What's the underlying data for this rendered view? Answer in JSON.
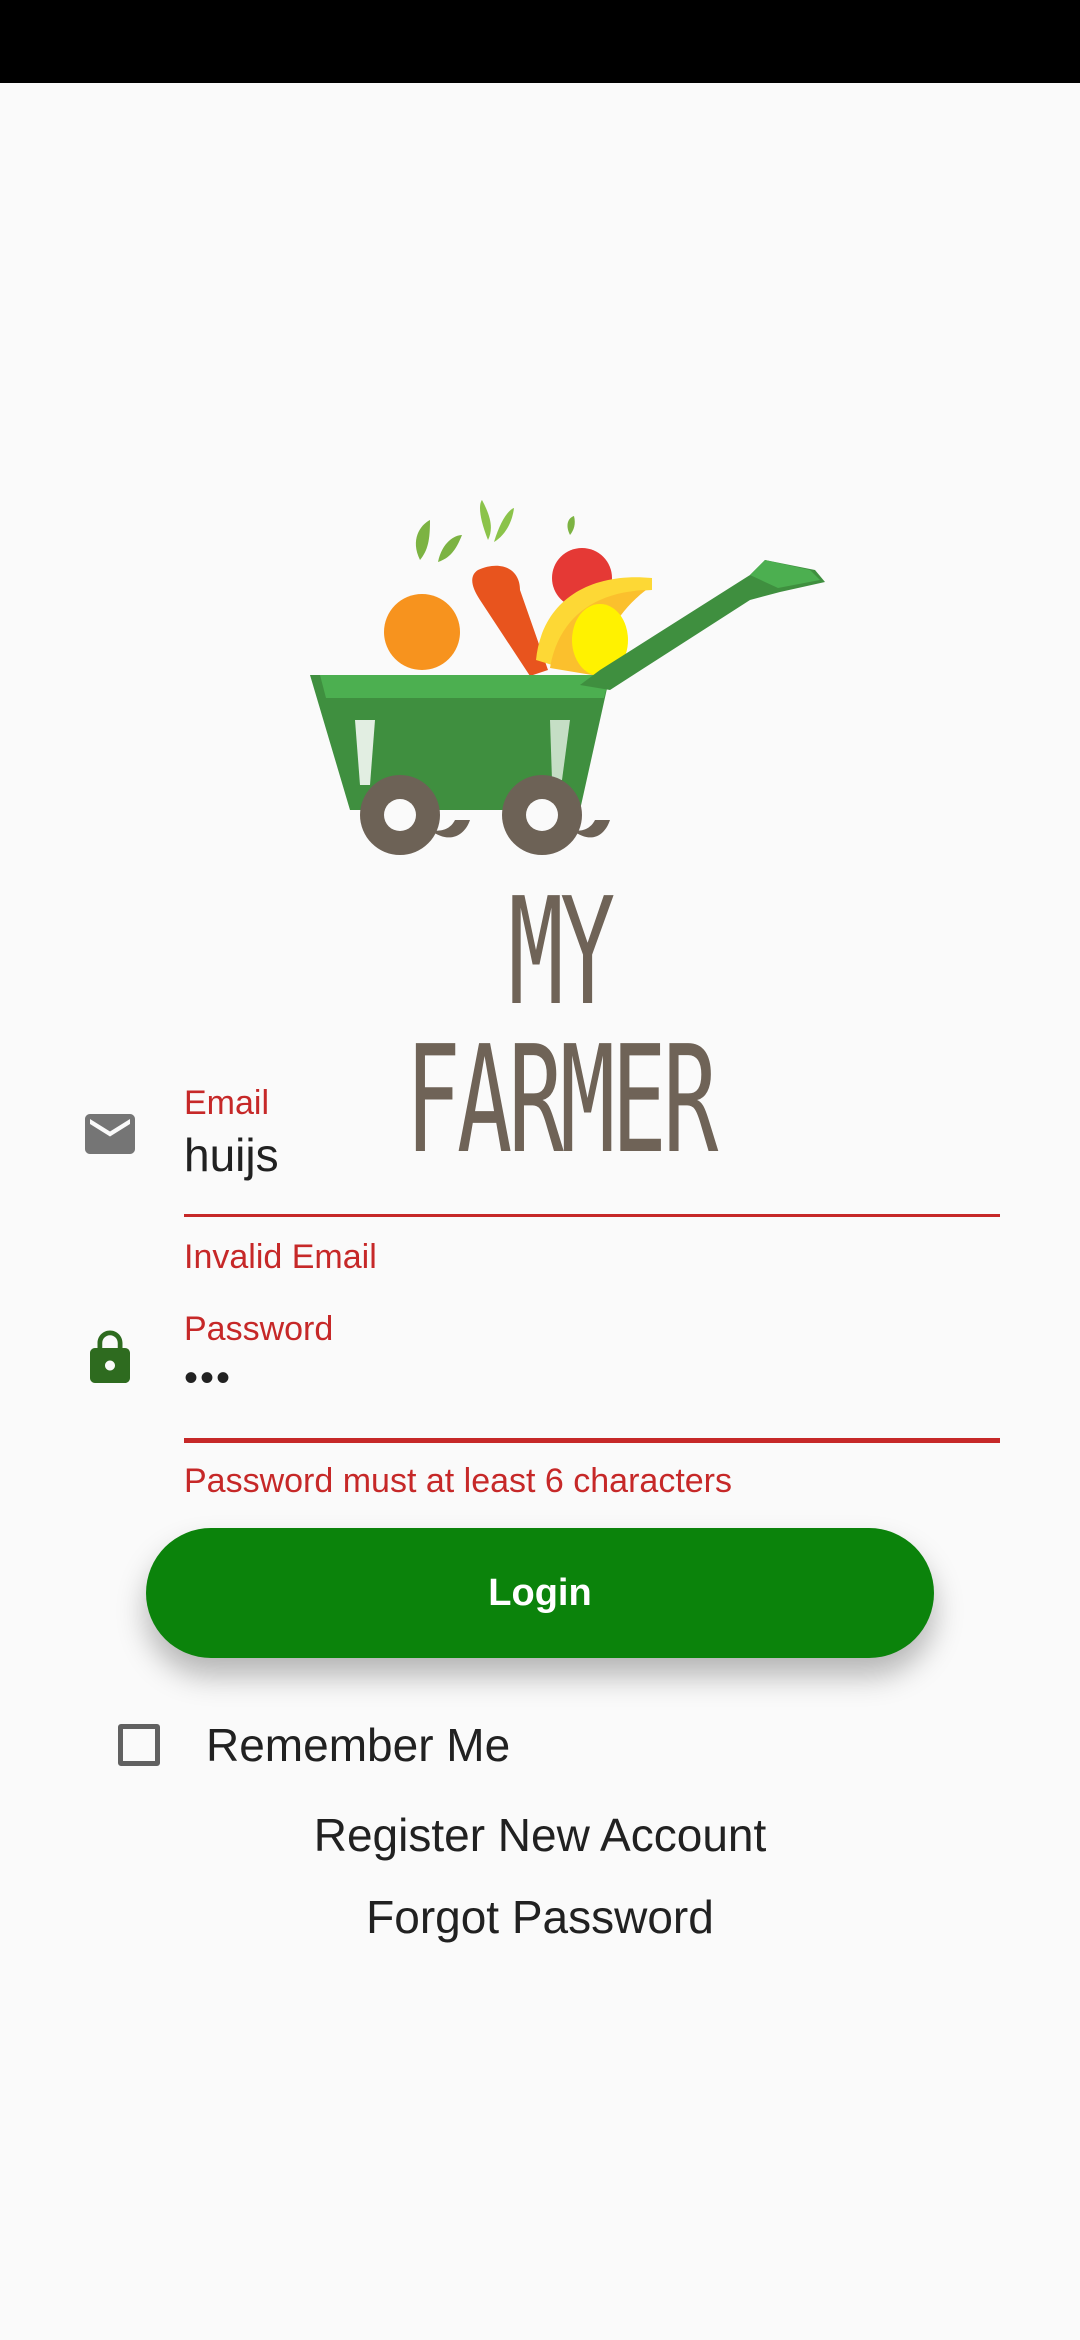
{
  "app": {
    "logo_text": "MY FARMER"
  },
  "form": {
    "email": {
      "label": "Email",
      "value": "huijs",
      "error": "Invalid Email",
      "icon": "mail-icon"
    },
    "password": {
      "label": "Password",
      "value": "•••",
      "error": "Password must at least 6 characters",
      "icon": "lock-icon"
    },
    "login_label": "Login",
    "remember_me": {
      "label": "Remember Me",
      "checked": false
    },
    "register_link": "Register New Account",
    "forgot_link": "Forgot Password"
  },
  "colors": {
    "accent_green": "#0b830b",
    "error_red": "#c62828",
    "lock_green": "#2e6b1f",
    "icon_grey": "#757575"
  }
}
